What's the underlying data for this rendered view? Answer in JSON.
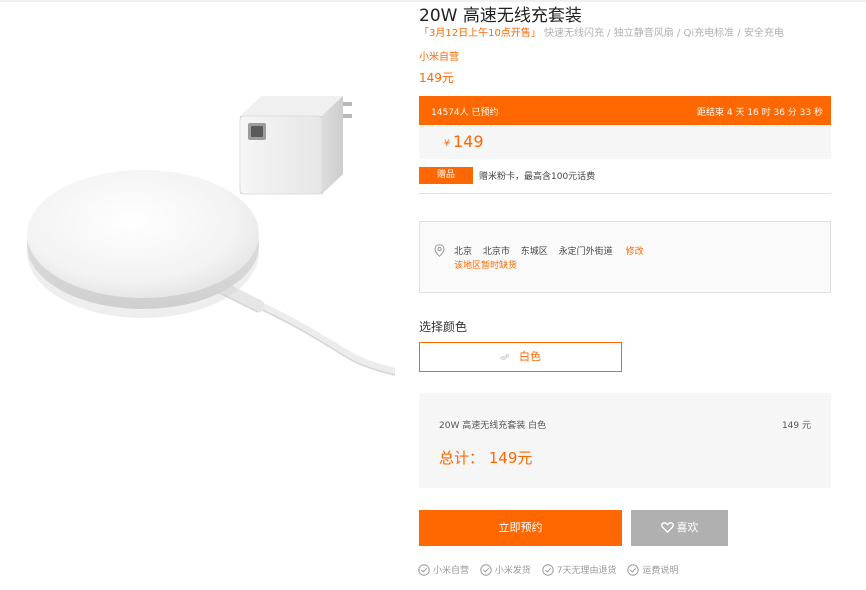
{
  "product": {
    "title": "20W 高速无线充套装",
    "promo_highlight": "「3月12日上午10点开售」",
    "promo_rest": "快速无线闪充 / 独立静音风扇 / Qi充电标准 / 安全充电",
    "seller": "小米自营",
    "price_line": "149元"
  },
  "reservation": {
    "count_text": "14574人 已预约",
    "countdown_text": "距结束 4 天 16 时 36 分 33 秒"
  },
  "price_box": {
    "currency": "¥",
    "amount": "149"
  },
  "gift": {
    "tag": "赠品",
    "text": "赠米粉卡，最高含100元话费"
  },
  "address": {
    "province": "北京",
    "city": "北京市",
    "district": "东城区",
    "street": "永定门外街道",
    "edit_label": "修改",
    "stock_notice": "该地区暂时缺货"
  },
  "color": {
    "label": "选择颜色",
    "selected": "白色"
  },
  "summary": {
    "item": "20W 高速无线充套装 白色",
    "item_price": "149 元",
    "total": "总计： 149元"
  },
  "actions": {
    "buy_label": "立即预约",
    "like_label": "喜欢"
  },
  "assurances": [
    "小米自营",
    "小米发货",
    "7天无理由退货",
    "运费说明"
  ],
  "colors": {
    "accent": "#ff6700",
    "like_bg": "#b0b0b0",
    "panel_bg": "#f6f6f6"
  }
}
